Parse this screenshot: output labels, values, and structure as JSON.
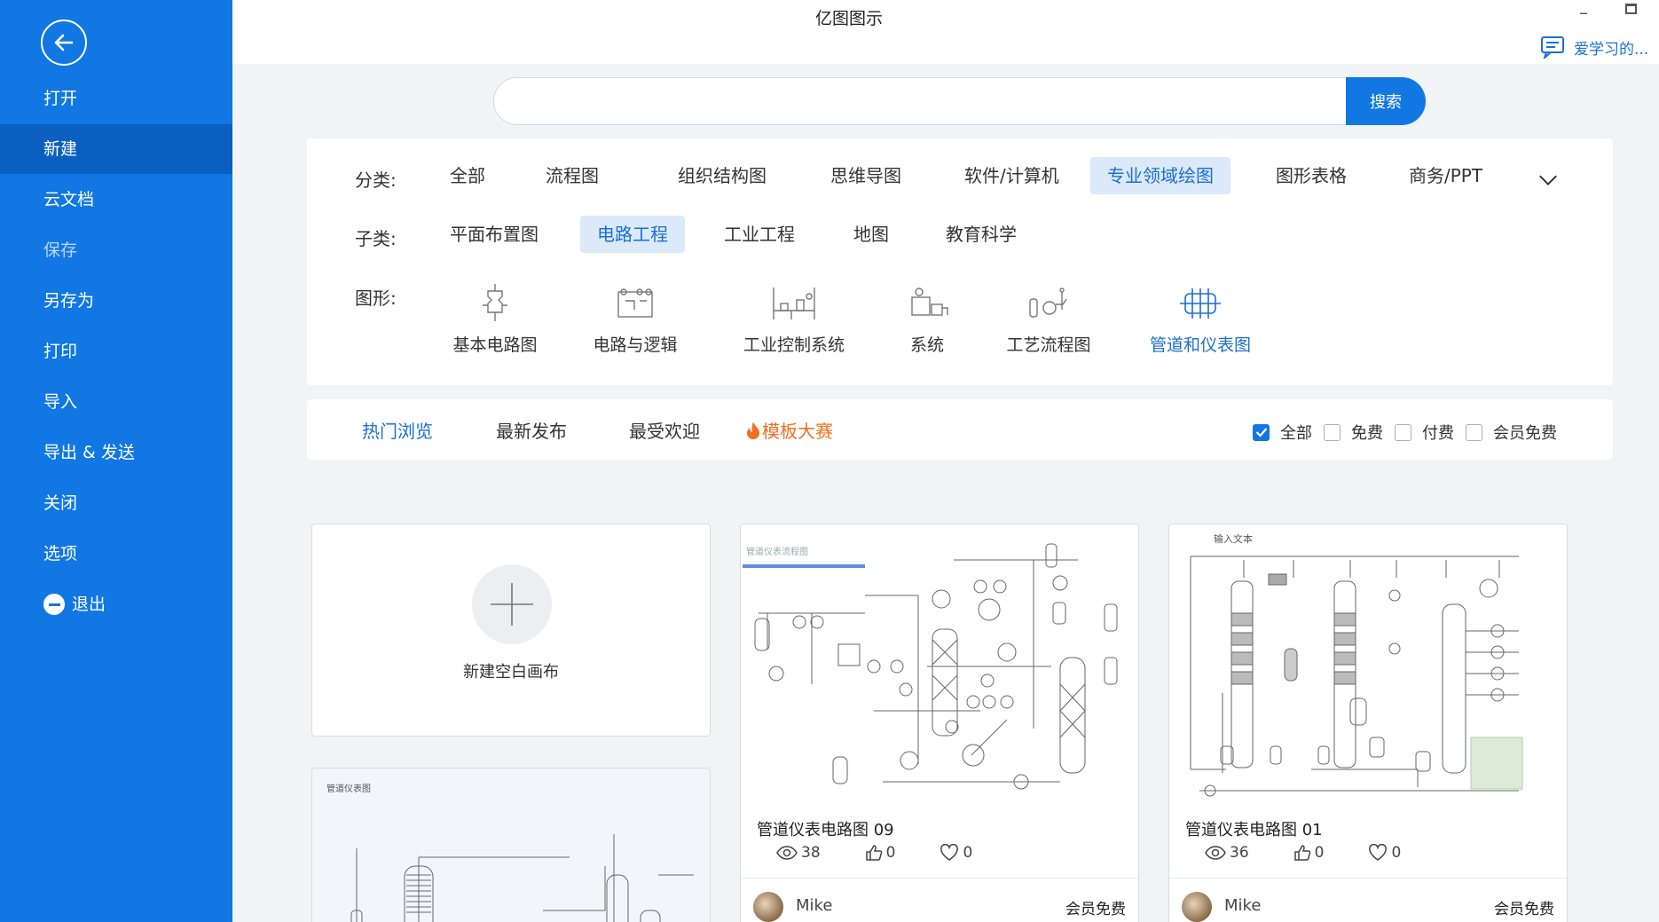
{
  "app": {
    "title": "亿图图示",
    "help_text": "爱学习的..."
  },
  "sidebar": {
    "items": [
      {
        "label": "打开"
      },
      {
        "label": "新建"
      },
      {
        "label": "云文档"
      },
      {
        "label": "保存"
      },
      {
        "label": "另存为"
      },
      {
        "label": "打印"
      },
      {
        "label": "导入"
      },
      {
        "label": "导出 & 发送"
      },
      {
        "label": "关闭"
      },
      {
        "label": "选项"
      },
      {
        "label": "退出"
      }
    ],
    "active": "新建"
  },
  "search": {
    "placeholder": "",
    "value": "",
    "button": "搜索"
  },
  "filters": {
    "category_label": "分类:",
    "categories": [
      "全部",
      "流程图",
      "组织结构图",
      "思维导图",
      "软件/计算机",
      "专业领域绘图",
      "图形表格",
      "商务/PPT"
    ],
    "category_selected": "专业领域绘图",
    "subcategory_label": "子类:",
    "subcategories": [
      "平面布置图",
      "电路工程",
      "工业工程",
      "地图",
      "教育科学"
    ],
    "subcategory_selected": "电路工程",
    "shape_label": "图形:",
    "shapes": [
      {
        "label": "基本电路图",
        "icon": "basic-circuit-icon"
      },
      {
        "label": "电路与逻辑",
        "icon": "circuit-logic-icon"
      },
      {
        "label": "工业控制系统",
        "icon": "industrial-control-icon"
      },
      {
        "label": "系统",
        "icon": "system-icon"
      },
      {
        "label": "工艺流程图",
        "icon": "process-flow-icon"
      },
      {
        "label": "管道和仪表图",
        "icon": "piping-instrument-icon"
      }
    ],
    "shape_selected": "管道和仪表图"
  },
  "tabs": {
    "items": [
      "热门浏览",
      "最新发布",
      "最受欢迎",
      "模板大赛"
    ],
    "active": "热门浏览",
    "price_filters": [
      {
        "label": "全部",
        "checked": true
      },
      {
        "label": "免费",
        "checked": false
      },
      {
        "label": "付费",
        "checked": false
      },
      {
        "label": "会员免费",
        "checked": false
      }
    ]
  },
  "new_blank": {
    "label": "新建空白画布"
  },
  "templates": [
    {
      "title": "管道仪表电路图 09",
      "views": "38",
      "likes": "0",
      "favorites": "0",
      "author": "Mike",
      "price": "会员免费",
      "thumb_caption": "管道仪表流程图"
    },
    {
      "title": "管道仪表电路图 01",
      "views": "36",
      "likes": "0",
      "favorites": "0",
      "author": "Mike",
      "price": "会员免费",
      "thumb_caption": "输入文本"
    },
    {
      "title": "",
      "thumb_caption": "管道仪表图"
    }
  ],
  "colors": {
    "brand": "#1177e3",
    "sidebar_active": "#0b5fc0",
    "accent_text": "#1b6fd1",
    "contest": "#f07022"
  }
}
